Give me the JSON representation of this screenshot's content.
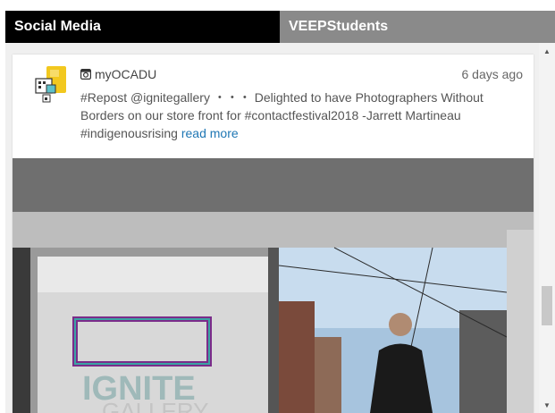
{
  "tabs": [
    {
      "label": "Social Media",
      "active": true
    },
    {
      "label": "VEEPStudents",
      "active": false
    }
  ],
  "post": {
    "account": "myOCADU",
    "time": "6 days ago",
    "text": "#Repost @ignitegallery ・・・ Delighted to have Photographers Without Borders on our store front for #contactfestival2018 -Jarrett Martineau #indigenousrising",
    "read_more": "read more",
    "source_icon": "instagram-icon",
    "photo_sign_text": "IGNITE",
    "photo_sign_text2": "GALLERY"
  },
  "colors": {
    "active_tab": "#000000",
    "inactive_tab": "#8a8a8a",
    "link": "#1f77b4",
    "feed_bg": "#f0f0f0"
  }
}
